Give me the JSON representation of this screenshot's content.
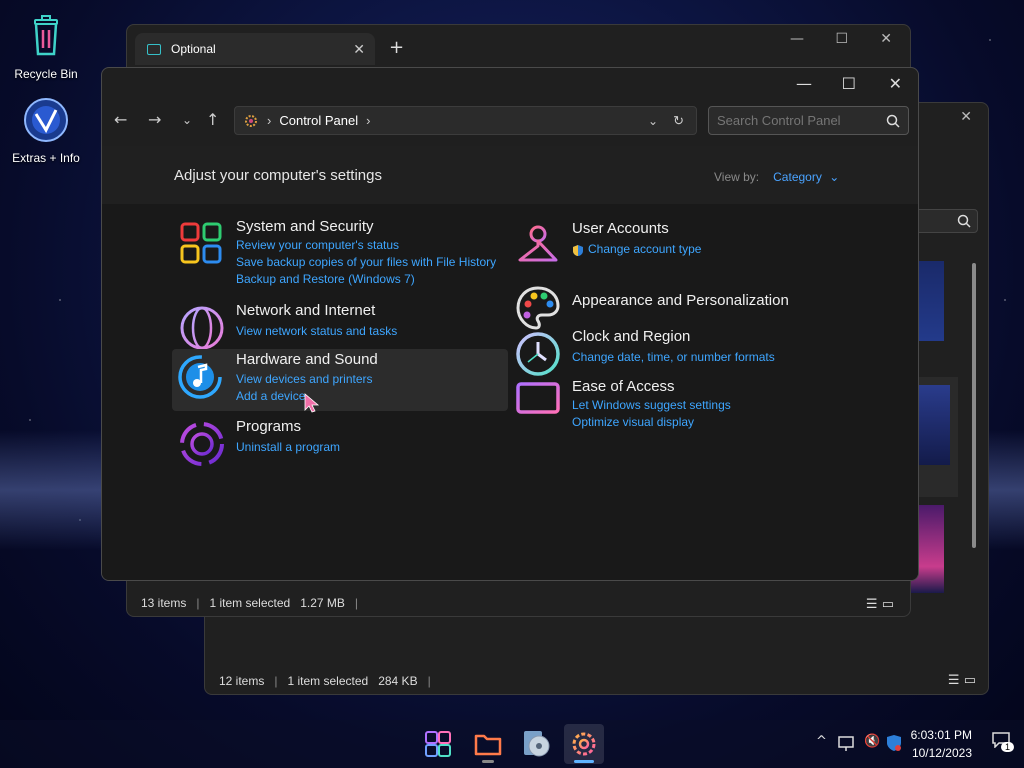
{
  "desktop": {
    "icons": [
      {
        "label": "Recycle Bin"
      },
      {
        "label": "Extras + Info"
      }
    ]
  },
  "explorer_back": {
    "status": {
      "items": "12 items",
      "selected": "1 item selected",
      "size": "284 KB"
    }
  },
  "explorer_front": {
    "tab_title": "Optional",
    "status": {
      "items": "13 items",
      "selected": "1 item selected",
      "size": "1.27 MB"
    }
  },
  "control_panel": {
    "address": "Control Panel",
    "search_placeholder": "Search Control Panel",
    "heading": "Adjust your computer's settings",
    "view_by_label": "View by:",
    "view_by_value": "Category",
    "left": [
      {
        "name": "System and Security",
        "links": [
          "Review your computer's status",
          "Save backup copies of your files with File History",
          "Backup and Restore (Windows 7)"
        ]
      },
      {
        "name": "Network and Internet",
        "links": [
          "View network status and tasks"
        ]
      },
      {
        "name": "Hardware and Sound",
        "links": [
          "View devices and printers",
          "Add a device"
        ]
      },
      {
        "name": "Programs",
        "links": [
          "Uninstall a program"
        ]
      }
    ],
    "right": [
      {
        "name": "User Accounts",
        "links": [
          "Change account type"
        ]
      },
      {
        "name": "Appearance and Personalization",
        "links": []
      },
      {
        "name": "Clock and Region",
        "links": [
          "Change date, time, or number formats"
        ]
      },
      {
        "name": "Ease of Access",
        "links": [
          "Let Windows suggest settings",
          "Optimize visual display"
        ]
      }
    ]
  },
  "taskbar": {
    "time": "6:03:01 PM",
    "date": "10/12/2023",
    "notification_count": "1"
  },
  "colors": {
    "link": "#3ea6ff",
    "accent": "#5fb3ff"
  }
}
